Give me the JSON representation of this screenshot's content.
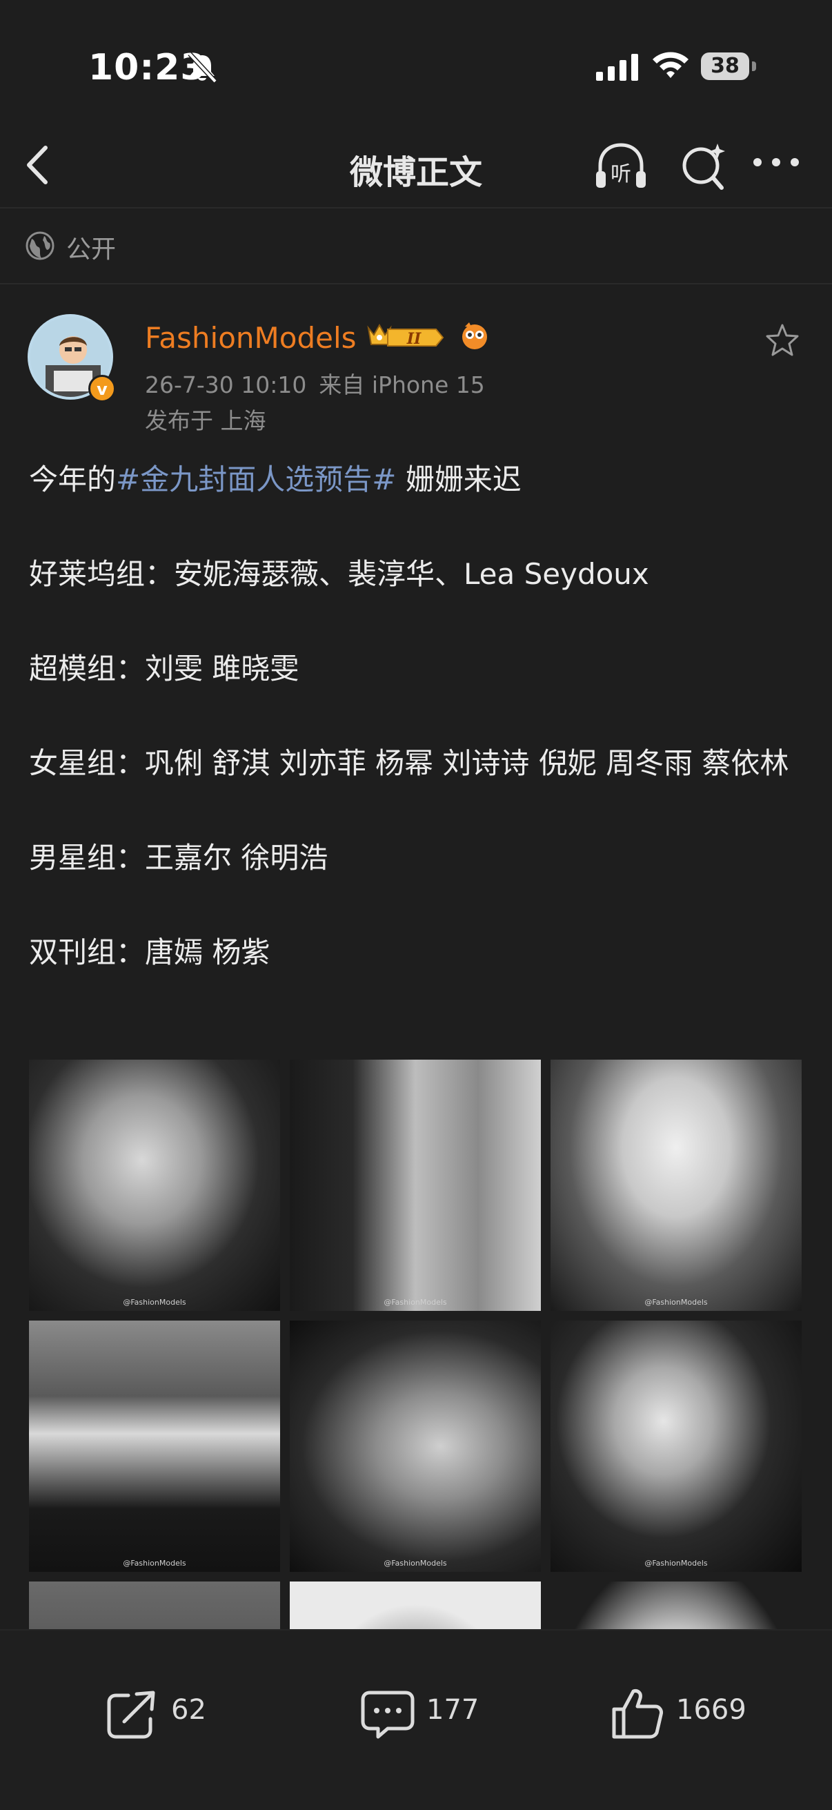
{
  "status_bar": {
    "time": "10:23",
    "battery": "38",
    "icons": [
      "bell-slash-icon",
      "signal-icon",
      "wifi-icon",
      "battery-icon"
    ]
  },
  "nav": {
    "title": "微博正文",
    "icons": [
      "back-chevron-icon",
      "listen-icon",
      "search-icon",
      "more-icon"
    ],
    "listen_glyph": "听"
  },
  "visibility": {
    "label": "公开",
    "icon": "globe-icon"
  },
  "post": {
    "author": "FashionModels",
    "badge_level": "II",
    "verified_mark": "v",
    "date": "26-7-30 10:10",
    "source": "来自 iPhone 15",
    "location": "发布于 上海",
    "intro_prefix": "今年的",
    "topic": "#金九封面人选预告#",
    "intro_suffix": " 姗姗来迟",
    "groups": [
      "好莱坞组：安妮海瑟薇、裴淳华、Lea Seydoux",
      "超模组：刘雯 雎晓雯",
      "女星组：巩俐 舒淇 刘亦菲 杨幂 刘诗诗 倪妮 周冬雨 蔡依林",
      "男星组：王嘉尔 徐明浩",
      "双刊组：唐嫣 杨紫"
    ],
    "watermark": "@FashionModels"
  },
  "actions": {
    "repost_count": "62",
    "comment_count": "177",
    "like_count": "1669"
  },
  "colors": {
    "background": "#1e1e1e",
    "username": "#ee7d22",
    "topic": "#7b97c7",
    "verified": "#f39a1c"
  }
}
